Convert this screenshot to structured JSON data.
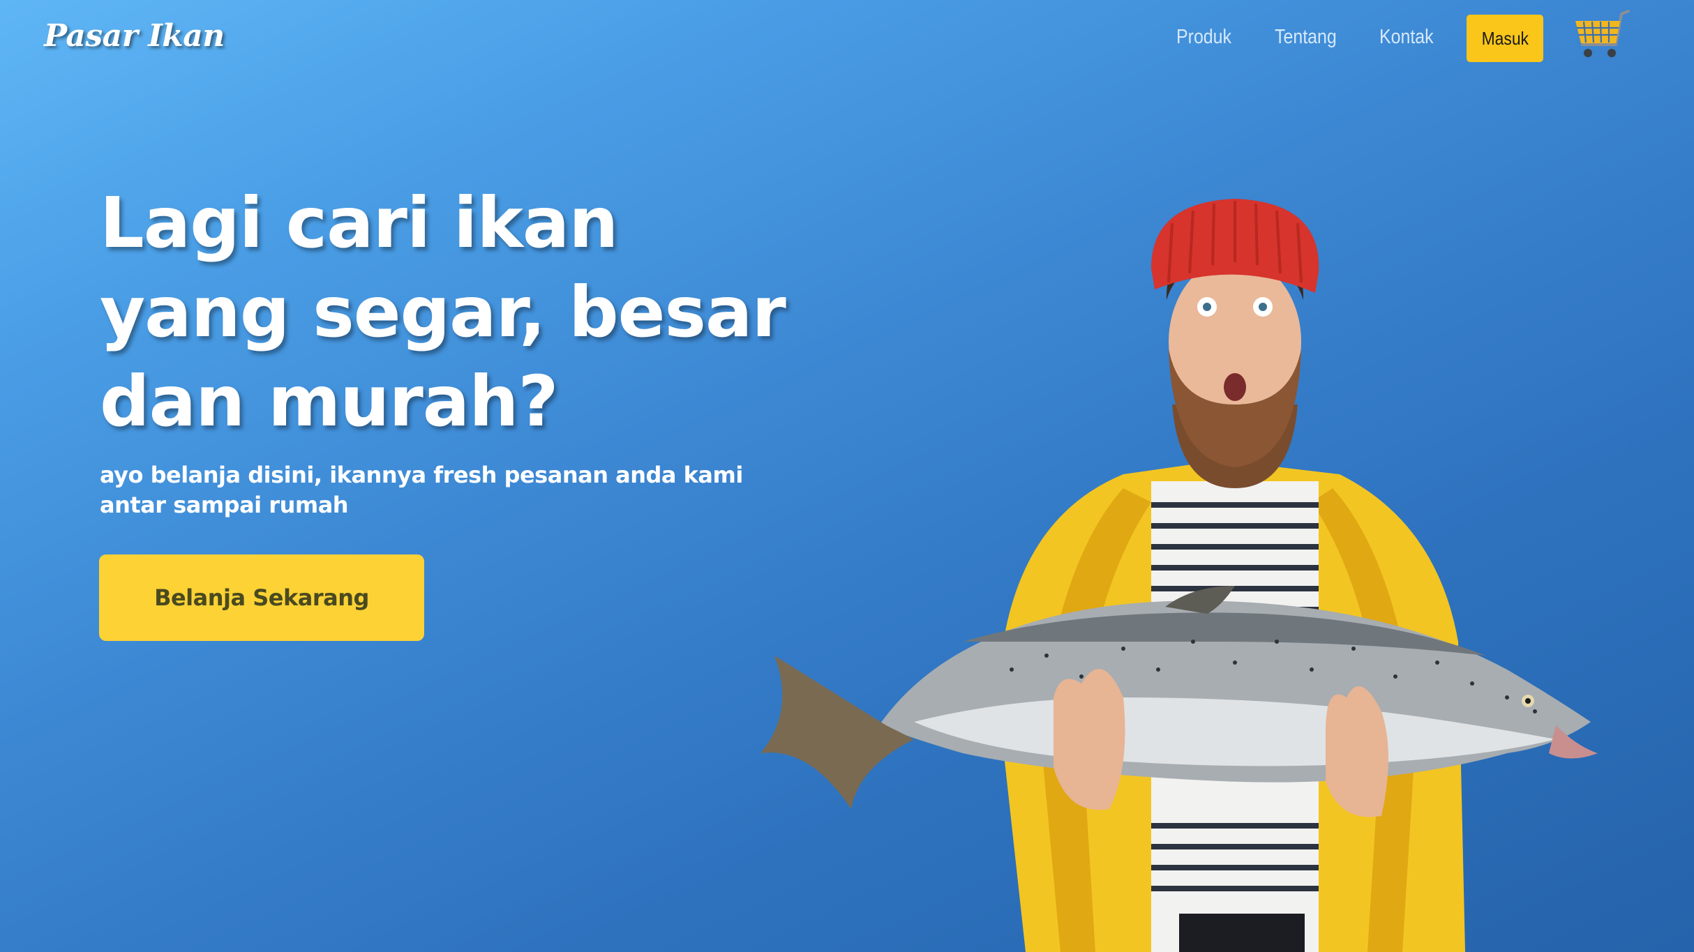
{
  "header": {
    "logo": "Pasar Ikan",
    "nav": [
      {
        "label": "Produk"
      },
      {
        "label": "Tentang"
      },
      {
        "label": "Kontak"
      }
    ],
    "login_label": "Masuk",
    "cart_icon": "shopping-cart-icon"
  },
  "hero": {
    "headline": "Lagi cari ikan yang segar, besar dan murah?",
    "subtext": "ayo belanja disini, ikannya fresh pesanan anda kami antar sampai rumah",
    "cta_label": "Belanja Sekarang"
  },
  "colors": {
    "background_top": "#5fb6f5",
    "background_bottom": "#2563ab",
    "accent_yellow": "#fcd235",
    "login_button": "#fbc61a",
    "cart_icon": "#f2b71f"
  }
}
